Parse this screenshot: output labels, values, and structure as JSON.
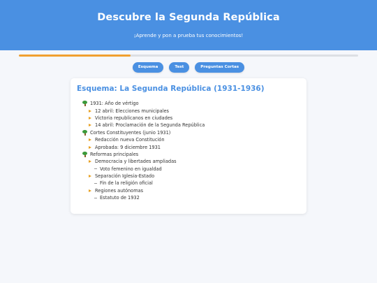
{
  "header": {
    "title": "Descubre la Segunda República",
    "subtitle": "¡Aprende y pon a prueba tus conocimientos!"
  },
  "progress": {
    "value": 0.33
  },
  "tabs": [
    {
      "label": "Esquema"
    },
    {
      "label": "Test"
    },
    {
      "label": "Preguntas Cortas"
    }
  ],
  "card": {
    "title": "Esquema: La Segunda República (1931-1936)"
  },
  "outline": [
    {
      "level": 1,
      "icon": "tree-icon",
      "text": "1931: Año de vértigo"
    },
    {
      "level": 2,
      "icon": "arrow-icon",
      "text": "12 abril: Elecciones municipales"
    },
    {
      "level": 2,
      "icon": "arrow-icon",
      "text": "Victoria republicanos en ciudades"
    },
    {
      "level": 2,
      "icon": "arrow-icon",
      "text": "14 abril: Proclamación de la Segunda República"
    },
    {
      "level": 1,
      "icon": "tree-icon",
      "text": "Cortes Constituyentes (junio 1931)"
    },
    {
      "level": 2,
      "icon": "arrow-icon",
      "text": "Redacción nueva Constitución"
    },
    {
      "level": 2,
      "icon": "arrow-icon",
      "text": "Aprobada: 9 diciembre 1931"
    },
    {
      "level": 1,
      "icon": "tree-icon",
      "text": "Reformas principales"
    },
    {
      "level": 2,
      "icon": "arrow-icon",
      "text": "Democracia y libertades ampliadas"
    },
    {
      "level": 3,
      "icon": "dash-icon",
      "text": "Voto femenino en igualdad"
    },
    {
      "level": 2,
      "icon": "arrow-icon",
      "text": "Separación Iglesia-Estado"
    },
    {
      "level": 3,
      "icon": "dash-icon",
      "text": "Fin de la religión oficial"
    },
    {
      "level": 2,
      "icon": "arrow-icon",
      "text": "Regiones autónomas"
    },
    {
      "level": 3,
      "icon": "dash-icon",
      "text": "Estatuto de 1932"
    }
  ],
  "colors": {
    "accent": "#4a90e2",
    "progress": "#f0a030",
    "tree": "#3a9a3a",
    "arrow": "#e8a020"
  }
}
